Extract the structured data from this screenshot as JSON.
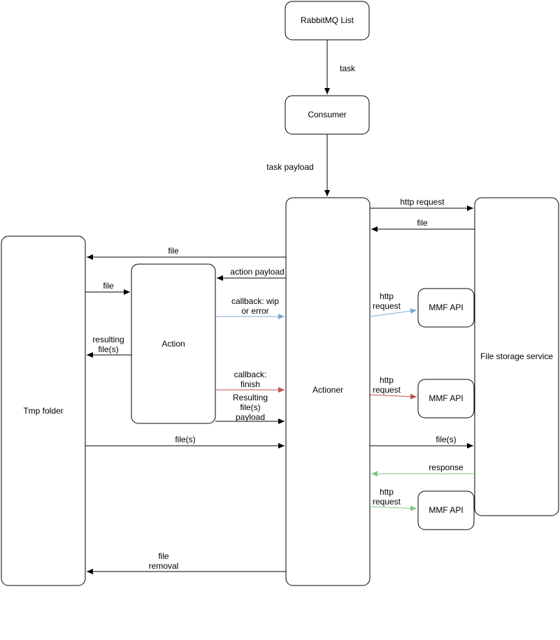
{
  "nodes": {
    "rabbitmq": "RabbitMQ List",
    "consumer": "Consumer",
    "actioner": "Actioner",
    "file_storage": "File storage service",
    "tmp_folder": "Tmp folder",
    "action": "Action",
    "mmf_api": "MMF API"
  },
  "edges": {
    "task": "task",
    "task_payload": "task payload",
    "http_request": "http request",
    "http_request_ml": [
      "http",
      "request"
    ],
    "file": "file",
    "action_payload": "action payload",
    "callback_wip": [
      "callback: wip",
      "or error"
    ],
    "callback_finish": [
      "callback:",
      "finish"
    ],
    "resulting_files": [
      "resulting",
      "file(s)"
    ],
    "resulting_files_payload": [
      "Resulting",
      "file(s)",
      "payload"
    ],
    "files": "file(s)",
    "file_removal": [
      "file",
      "removal"
    ],
    "response": "response"
  },
  "colors": {
    "black": "#000000",
    "blue": "#7ea6d9",
    "red": "#c04f4f",
    "green": "#82c785"
  }
}
